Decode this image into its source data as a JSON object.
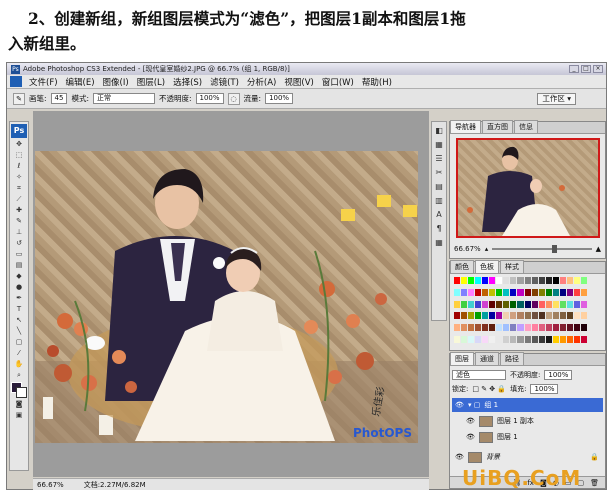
{
  "caption": {
    "line1": "2、创建新组，新组图层模式为“滤色”，把图层1副本和图层1拖",
    "line2": "入新组里。"
  },
  "window": {
    "title": "Adobe Photoshop CS3 Extended - [现代皇室婚纱2.JPG @ 66.7% (组 1, RGB/8)]",
    "controls": [
      "_",
      "□",
      "×"
    ]
  },
  "menu": [
    "文件(F)",
    "编辑(E)",
    "图像(I)",
    "图层(L)",
    "选择(S)",
    "滤镜(T)",
    "分析(A)",
    "视图(V)",
    "窗口(W)",
    "帮助(H)"
  ],
  "options": {
    "brush_label": "画笔:",
    "brush_size": "45",
    "mode_label": "模式:",
    "mode_value": "正常",
    "opacity_label": "不透明度:",
    "opacity_value": "100%",
    "flow_label": "流量:",
    "flow_value": "100%",
    "workspace": "工作区 ▾"
  },
  "status": {
    "zoom": "66.67%",
    "doc": "文档:2.27M/6.82M"
  },
  "photo_text": {
    "signature": "乐佳彩",
    "logo_text": "PhotOPS"
  },
  "navigator": {
    "tabs": [
      "导航器",
      "直方图",
      "信息"
    ],
    "zoom": "66.67%"
  },
  "colorpanel": {
    "tabs": [
      "颜色",
      "色板",
      "样式"
    ],
    "colors": [
      "#ff0000",
      "#ffff00",
      "#00ff00",
      "#00ffff",
      "#0000ff",
      "#ff00ff",
      "#ffffff",
      "#e0e0e0",
      "#c0c0c0",
      "#a0a0a0",
      "#808080",
      "#606060",
      "#404040",
      "#202020",
      "#000000",
      "#ff8080",
      "#ffc080",
      "#ffff80",
      "#80ff80",
      "#80ffff",
      "#8080ff",
      "#ff80ff",
      "#c00000",
      "#c06000",
      "#c0c000",
      "#00c000",
      "#00c0c0",
      "#0000c0",
      "#c000c0",
      "#800000",
      "#804000",
      "#808000",
      "#008000",
      "#008080",
      "#000080",
      "#800080",
      "#ff4040",
      "#ffa040",
      "#ffd040",
      "#40d040",
      "#40d0d0",
      "#4040d0",
      "#d040d0",
      "#600000",
      "#603000",
      "#606000",
      "#006000",
      "#006060",
      "#000060",
      "#600060",
      "#ff6060",
      "#ff9060",
      "#ffe060",
      "#60e060",
      "#60e0e0",
      "#6060e0",
      "#e060e0",
      "#a00000",
      "#a05000",
      "#a0a000",
      "#00a000",
      "#00a0a0",
      "#0000a0",
      "#a000a0",
      "#f0d0b0",
      "#d0a080",
      "#b08060",
      "#907050",
      "#705040",
      "#503020",
      "#c0a080",
      "#a08060",
      "#806040",
      "#604020",
      "#ffe0c0",
      "#ffd0a0",
      "#ffb080",
      "#e09060",
      "#c07040",
      "#a05030",
      "#803020",
      "#602010",
      "#c0e0ff",
      "#a0c0ff",
      "#8080c0",
      "#c0a0ff",
      "#ffa0c0",
      "#ff80a0",
      "#e06080",
      "#c04060",
      "#a02040",
      "#802030",
      "#601020",
      "#400010",
      "#200008",
      "#f8f8d8",
      "#d8f8d8",
      "#d8f8f8",
      "#d8d8f8",
      "#f8d8f8",
      "#f0f0f0",
      "#e8e8e8",
      "#d0d0d0",
      "#b8b8b8",
      "#989898",
      "#787878",
      "#585858",
      "#383838",
      "#181818",
      "#ffcc00",
      "#ff9900",
      "#ff6600",
      "#ff3300",
      "#cc0033"
    ]
  },
  "layers": {
    "tabs": [
      "图层",
      "通道",
      "路径"
    ],
    "blend_mode": "滤色",
    "opacity_label": "不透明度:",
    "opacity_value": "100%",
    "lock_label": "锁定:",
    "fill_label": "填充:",
    "fill_value": "100%",
    "items": [
      {
        "name": "组 1",
        "selected": true
      },
      {
        "name": "图层 1 副本",
        "selected": false
      },
      {
        "name": "图层 1",
        "selected": false
      },
      {
        "name": "背景",
        "selected": false
      }
    ]
  },
  "watermark": "UiBQ.CoM"
}
